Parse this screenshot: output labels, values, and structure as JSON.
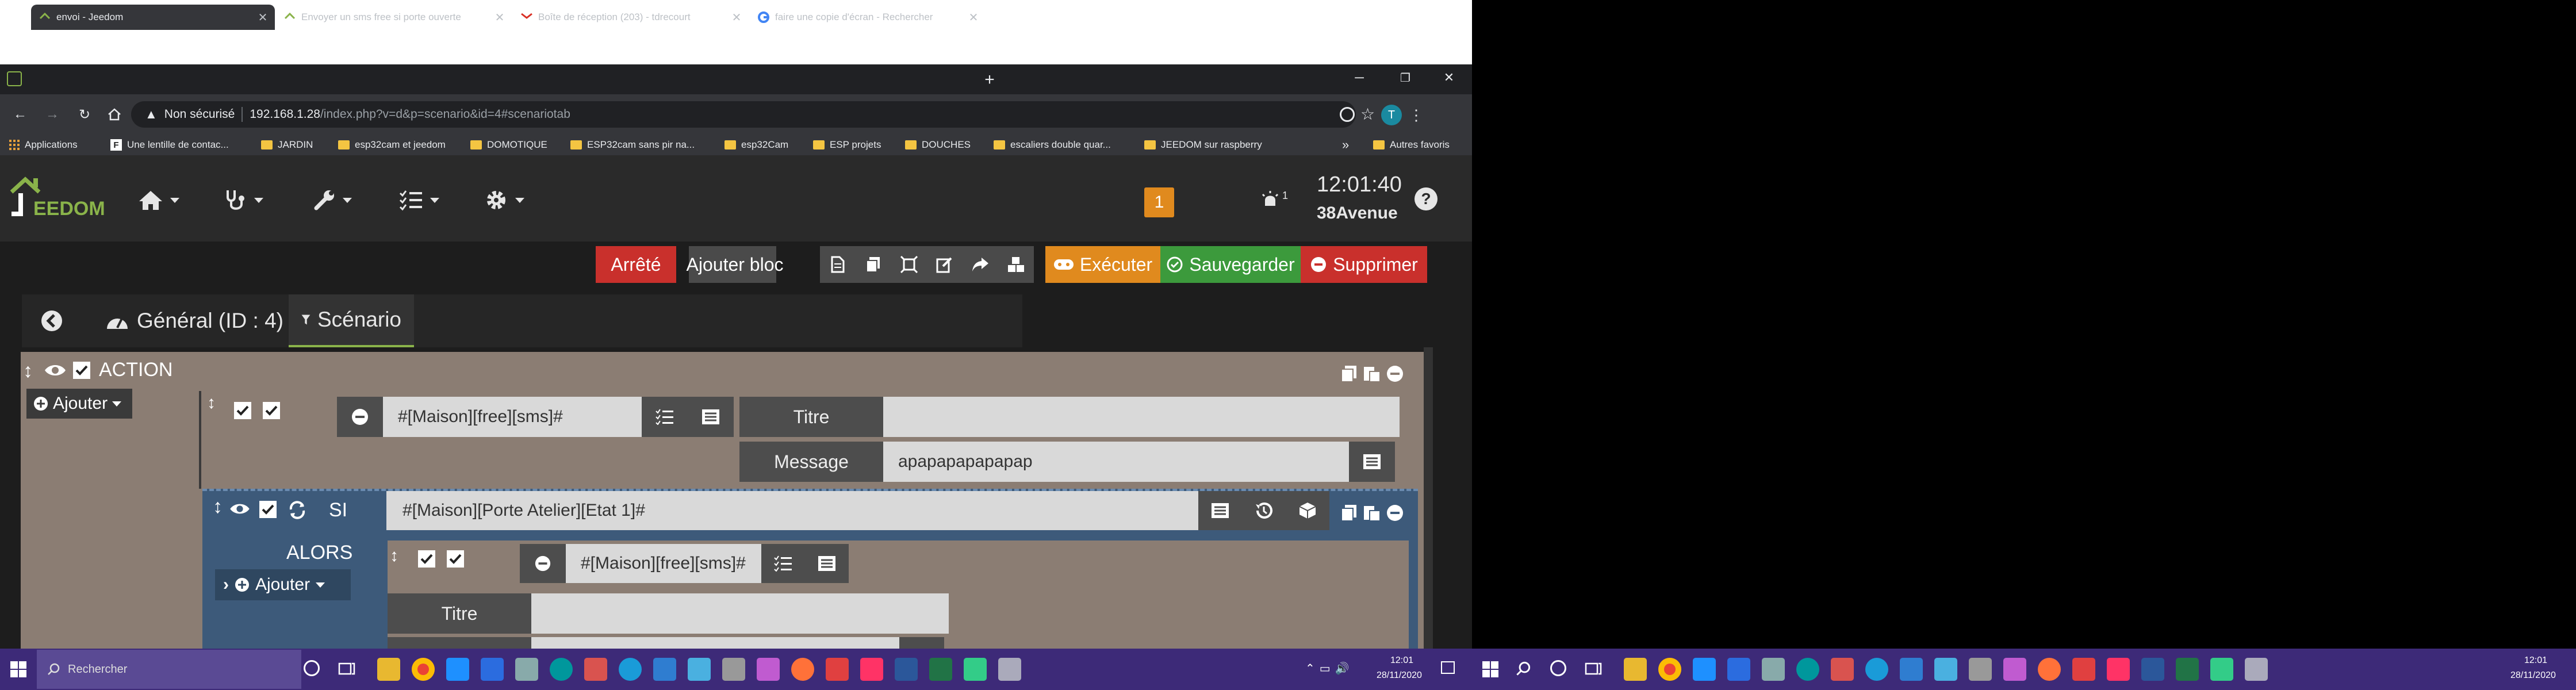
{
  "browser": {
    "tabs": [
      {
        "title": "envoi - Jeedom",
        "active": true
      },
      {
        "title": "Envoyer un sms free si porte ouverte",
        "active": false
      },
      {
        "title": "Boîte de réception (203) - tdrecourt",
        "active": false
      },
      {
        "title": "faire une copie d'écran - Rechercher",
        "active": false
      }
    ],
    "security": "Non sécurisé",
    "url_host": "192.168.1.28",
    "url_path": "/index.php?v=d&p=scenario&id=4#scenariotab",
    "profile_initial": "T",
    "bookmarks": [
      {
        "label": "Applications",
        "icon": "apps-grid-icon"
      },
      {
        "label": "Une lentille de contac...",
        "icon": "f-favicon-icon"
      },
      {
        "label": "JARDIN",
        "icon": "folder-icon"
      },
      {
        "label": "esp32cam et jeedom",
        "icon": "folder-icon"
      },
      {
        "label": "DOMOTIQUE",
        "icon": "folder-icon"
      },
      {
        "label": "ESP32cam sans pir na...",
        "icon": "folder-icon"
      },
      {
        "label": "esp32Cam",
        "icon": "folder-icon"
      },
      {
        "label": "ESP projets",
        "icon": "folder-icon"
      },
      {
        "label": "DOUCHES",
        "icon": "folder-icon"
      },
      {
        "label": "escaliers double quar...",
        "icon": "folder-icon"
      },
      {
        "label": "JEEDOM sur raspberry",
        "icon": "folder-icon"
      }
    ],
    "bookmarks_overflow": "»",
    "other_bookmarks": "Autres favoris"
  },
  "jeedom": {
    "logo_text": "EEDOM",
    "notification_count": "1",
    "alert_count": "1",
    "time": "12:01:40",
    "location": "38Avenue",
    "status_label": "Arrêté",
    "toolbar": {
      "add_block": "Ajouter bloc",
      "execute": "Exécuter",
      "save": "Sauvegarder",
      "delete": "Supprimer"
    },
    "tabs": {
      "general": "Général (ID : 4)",
      "scenario": "Scénario"
    },
    "action_block": {
      "title": "ACTION",
      "add_label": "Ajouter",
      "command": "#[Maison][free][sms]#",
      "title_label": "Titre",
      "title_value": "",
      "message_label": "Message",
      "message_value": "apapapapapapap"
    },
    "si_block": {
      "si_label": "SI",
      "condition": "#[Maison][Porte Atelier][Etat 1]#",
      "alors_label": "ALORS",
      "add_label": "Ajouter",
      "command": "#[Maison][free][sms]#",
      "title_label": "Titre",
      "title_value": ""
    }
  },
  "taskbar": {
    "search_placeholder": "Rechercher",
    "time": "12:01",
    "date": "28/11/2020",
    "time2": "12:01",
    "date2": "28/11/2020"
  },
  "colors": {
    "danger": "#c9302c",
    "warning": "#e08a1e",
    "success": "#3c9a3c",
    "panel": "#8b7d73",
    "si_panel": "#3d5a7a",
    "taskbar": "#3d2a78"
  }
}
